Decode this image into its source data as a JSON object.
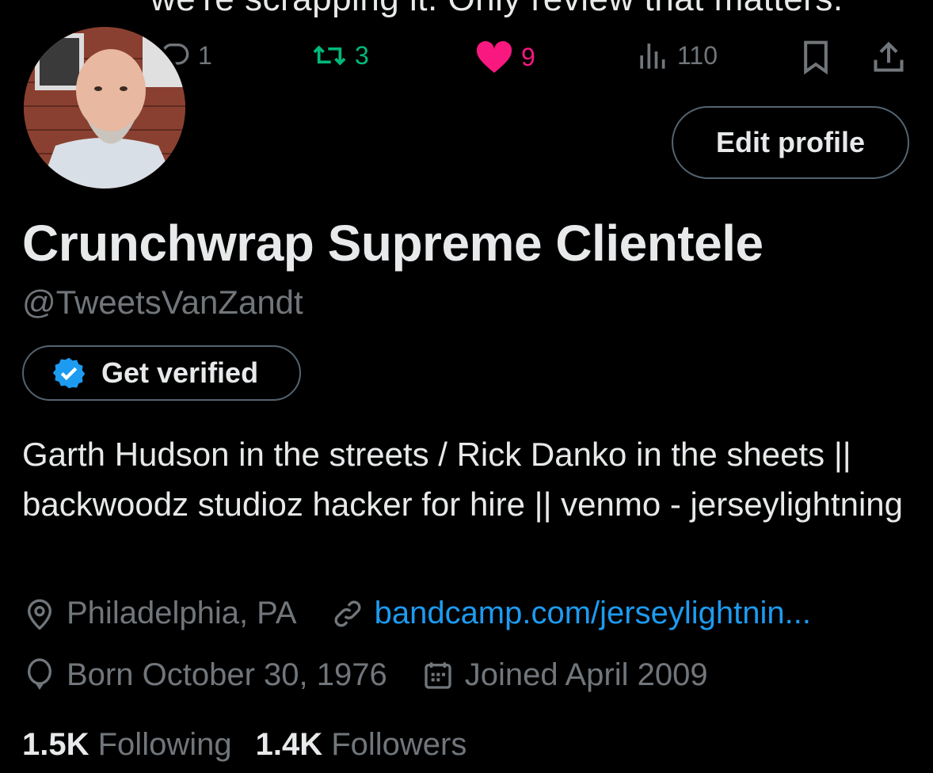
{
  "tweet": {
    "cut_text": "we're scrapping it. Only review that matters.",
    "replies": "1",
    "retweets": "3",
    "likes": "9",
    "views": "110"
  },
  "profile": {
    "edit_label": "Edit profile",
    "display_name": "Crunchwrap Supreme Clientele",
    "handle": "@TweetsVanZandt",
    "verify_label": "Get verified",
    "bio": "Garth Hudson in the streets / Rick Danko in the sheets || backwoodz studioz hacker for hire || venmo - jerseylightning",
    "location": "Philadelphia, PA",
    "website": "bandcamp.com/jerseylightnin...",
    "born": "Born October 30, 1976",
    "joined": "Joined April 2009",
    "following_count": "1.5K",
    "following_label": "Following",
    "followers_count": "1.4K",
    "followers_label": "Followers"
  },
  "colors": {
    "background": "#000000",
    "text": "#e7e9ea",
    "muted": "#71767b",
    "link": "#1d9bf0",
    "retweet": "#00ba7c",
    "like": "#f91880"
  }
}
